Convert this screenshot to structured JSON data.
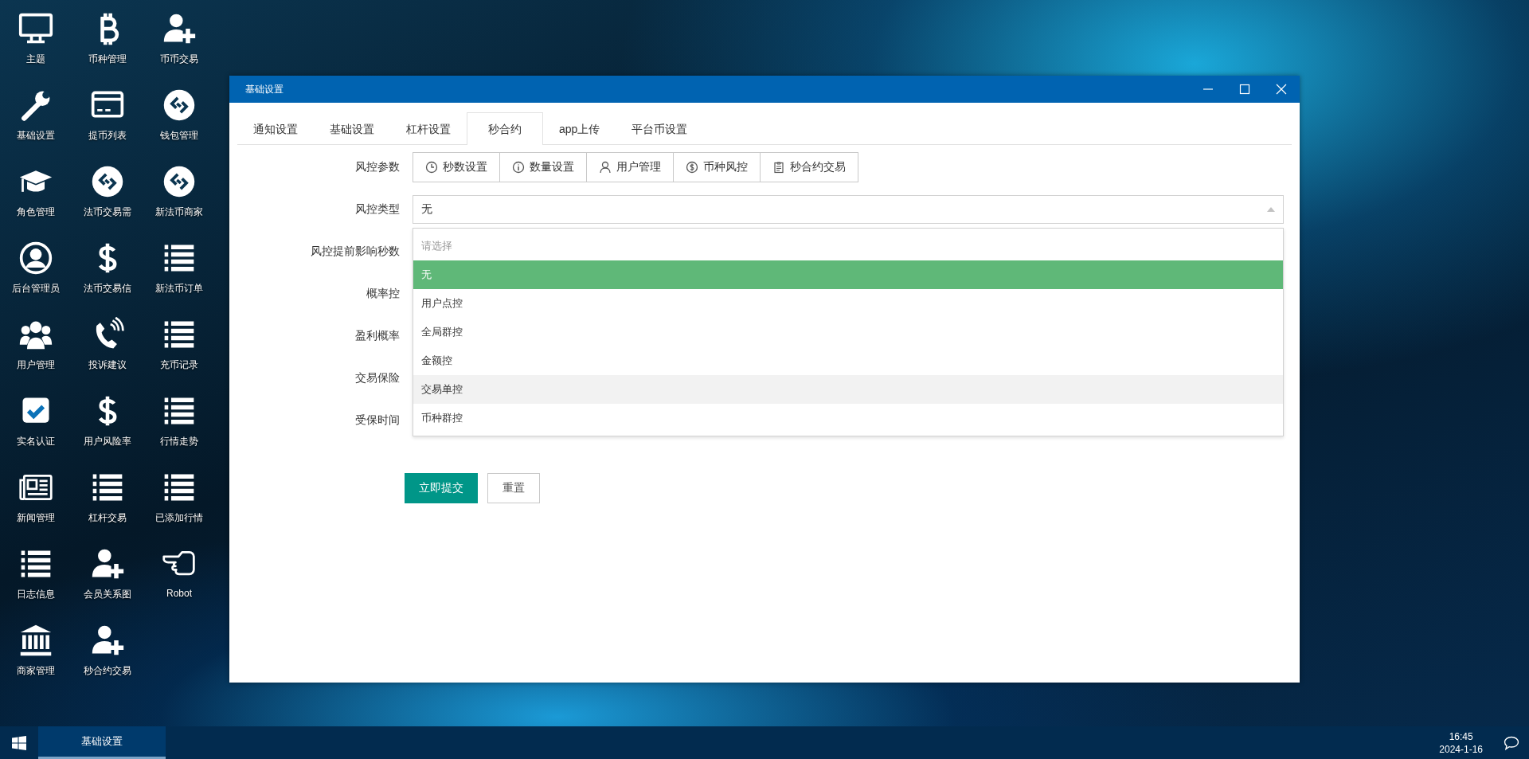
{
  "desktop_icons": [
    {
      "label": "主题",
      "kind": "monitor"
    },
    {
      "label": "币种管理",
      "kind": "bitcoin"
    },
    {
      "label": "币币交易",
      "kind": "user-plus"
    },
    {
      "label": "基础设置",
      "kind": "wrench"
    },
    {
      "label": "提币列表",
      "kind": "card"
    },
    {
      "label": "钱包管理",
      "kind": "link"
    },
    {
      "label": "角色管理",
      "kind": "cap"
    },
    {
      "label": "法币交易需",
      "kind": "link"
    },
    {
      "label": "新法币商家",
      "kind": "link"
    },
    {
      "label": "后台管理员",
      "kind": "user-circle"
    },
    {
      "label": "法币交易信",
      "kind": "dollar"
    },
    {
      "label": "新法币订单",
      "kind": "list"
    },
    {
      "label": "用户管理",
      "kind": "users"
    },
    {
      "label": "投诉建议",
      "kind": "phone"
    },
    {
      "label": "充币记录",
      "kind": "list"
    },
    {
      "label": "实名认证",
      "kind": "check"
    },
    {
      "label": "用户风险率",
      "kind": "dollar"
    },
    {
      "label": "行情走势",
      "kind": "list"
    },
    {
      "label": "新闻管理",
      "kind": "newspaper"
    },
    {
      "label": "杠杆交易",
      "kind": "list"
    },
    {
      "label": "已添加行情",
      "kind": "list"
    },
    {
      "label": "日志信息",
      "kind": "list"
    },
    {
      "label": "会员关系图",
      "kind": "user-plus"
    },
    {
      "label": "Robot",
      "kind": "hand"
    },
    {
      "label": "商家管理",
      "kind": "bank"
    },
    {
      "label": "秒合约交易",
      "kind": "user-plus"
    }
  ],
  "window": {
    "title": "基础设置",
    "tabs": [
      {
        "label": "通知设置",
        "selected": false
      },
      {
        "label": "基础设置",
        "selected": false
      },
      {
        "label": "杠杆设置",
        "selected": false
      },
      {
        "label": "秒合约",
        "selected": true
      },
      {
        "label": "app上传",
        "selected": false
      },
      {
        "label": "平台币设置",
        "selected": false
      }
    ],
    "form": {
      "param_label": "风控参数",
      "param_buttons": [
        {
          "label": "秒数设置",
          "kind": "clock"
        },
        {
          "label": "数量设置",
          "kind": "info"
        },
        {
          "label": "用户管理",
          "kind": "user"
        },
        {
          "label": "币种风控",
          "kind": "dollar"
        },
        {
          "label": "秒合约交易",
          "kind": "clipboard"
        }
      ],
      "type_label": "风控类型",
      "type_select": {
        "value": "无",
        "expanded": true,
        "hint_option": "请选择",
        "options": [
          {
            "label": "无",
            "selected": true,
            "hovered": false
          },
          {
            "label": "用户点控",
            "selected": false,
            "hovered": false
          },
          {
            "label": "全局群控",
            "selected": false,
            "hovered": false
          },
          {
            "label": "金额控",
            "selected": false,
            "hovered": false
          },
          {
            "label": "交易单控",
            "selected": false,
            "hovered": true
          },
          {
            "label": "币种群控",
            "selected": false,
            "hovered": false
          }
        ]
      },
      "field_labels": [
        "风控提前影响秒数",
        "概率控",
        "盈利概率",
        "交易保险",
        "受保时间"
      ],
      "submit_button": "立即提交",
      "reset_button": "重置"
    }
  },
  "taskbar": {
    "task": {
      "label": "基础设置",
      "active": true
    },
    "time": "16:45",
    "date": "2024-1-16"
  }
}
